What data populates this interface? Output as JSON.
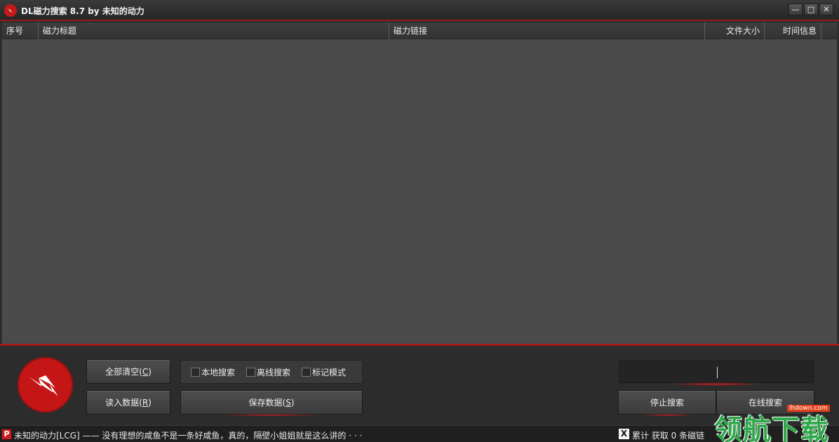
{
  "window": {
    "title": "DL磁力搜索 8.7 by 未知的动力",
    "controls": {
      "minimize": "—",
      "maximize": "□",
      "close": "✕"
    }
  },
  "table": {
    "columns": [
      {
        "label": "序号"
      },
      {
        "label": "磁力标题"
      },
      {
        "label": "磁力链接"
      },
      {
        "label": "文件大小"
      },
      {
        "label": "时间信息"
      },
      {
        "label": ""
      }
    ],
    "rows": []
  },
  "controls": {
    "clear_all": {
      "label": "全部清空",
      "accel": "C"
    },
    "load_data": {
      "label": "读入数据",
      "accel": "R"
    },
    "save_data": {
      "label": "保存数据",
      "accel": "S"
    },
    "options": [
      {
        "label": "本地搜索",
        "checked": false
      },
      {
        "label": "离线搜索",
        "checked": false
      },
      {
        "label": "标记模式",
        "checked": false
      }
    ],
    "search_value": "",
    "stop_search": "停止搜索",
    "online_search": "在线搜索"
  },
  "status": {
    "icon": "P",
    "message": "未知的动力[LCG] —— 没有理想的咸鱼不是一条好咸鱼，真的，隔壁小姐姐就是这么讲的 · · ·",
    "indicator_icon": "X",
    "count_text": "累计 获取 0 条磁链"
  },
  "watermark": {
    "text": "领航下载",
    "url": "lhdown.com"
  },
  "colors": {
    "accent": "#c41a1a",
    "background": "#4b4b4b",
    "panel": "#2c2c2c",
    "watermark": "#2ea84a"
  },
  "icons": {
    "app": "lightning-logo-icon",
    "logo": "lightning-logo-icon"
  }
}
